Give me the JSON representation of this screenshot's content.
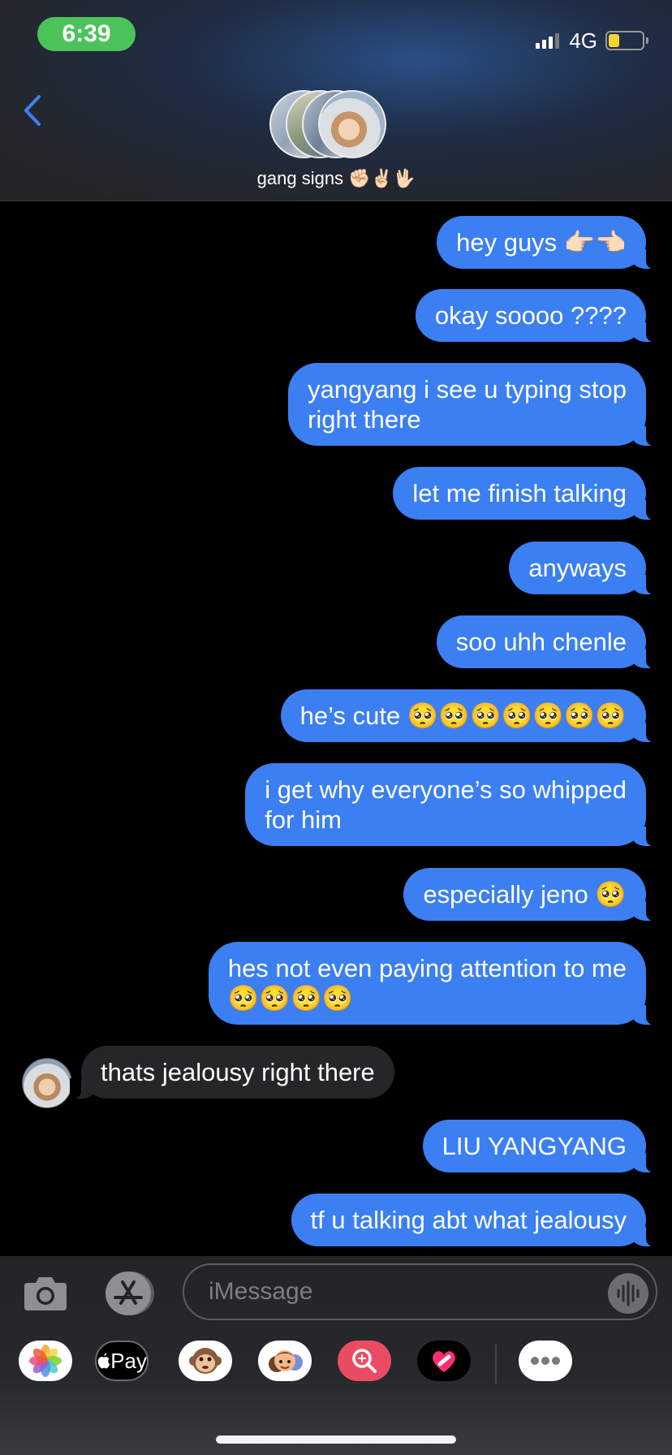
{
  "status_bar": {
    "time": "6:39",
    "network": "4G",
    "signal_bars": 3,
    "battery_level": 0.35
  },
  "header": {
    "back_icon": "chevron-left-icon",
    "group_name": "gang signs ✊🏻✌🏻🖖🏻"
  },
  "messages": [
    {
      "direction": "outgoing",
      "lines": [
        "hey guys 👉🏻👈🏻"
      ]
    },
    {
      "direction": "outgoing",
      "lines": [
        "okay soooo ????"
      ]
    },
    {
      "direction": "outgoing",
      "lines": [
        "yangyang i see u typing stop",
        "right there"
      ]
    },
    {
      "direction": "outgoing",
      "lines": [
        "let me finish talking"
      ]
    },
    {
      "direction": "outgoing",
      "lines": [
        "anyways"
      ]
    },
    {
      "direction": "outgoing",
      "lines": [
        "soo uhh chenle"
      ]
    },
    {
      "direction": "outgoing",
      "lines": [
        "he’s cute 🥺🥺🥺🥺🥺🥺🥺"
      ]
    },
    {
      "direction": "outgoing",
      "lines": [
        "i get why everyone’s so whipped",
        "for him"
      ]
    },
    {
      "direction": "outgoing",
      "lines": [
        "especially jeno 🥺"
      ]
    },
    {
      "direction": "outgoing",
      "lines": [
        "hes not even paying attention to me",
        "🥺🥺🥺🥺"
      ]
    },
    {
      "direction": "incoming",
      "lines": [
        "thats jealousy right there"
      ]
    },
    {
      "direction": "outgoing",
      "lines": [
        "LIU YANGYANG"
      ]
    },
    {
      "direction": "outgoing",
      "lines": [
        "tf u talking abt what jealousy"
      ]
    }
  ],
  "compose": {
    "placeholder": "iMessage",
    "camera_icon": "camera-icon",
    "appstore_icon": "app-store-icon",
    "audio_icon": "audio-waveform-icon",
    "apple_pay_label": "Pay",
    "apps": [
      "photos-app-icon",
      "apple-pay-icon",
      "animoji-monkey-icon",
      "memoji-icon",
      "image-search-icon",
      "digital-touch-heart-icon",
      "more-apps-icon"
    ]
  },
  "colors": {
    "outgoing_bubble": "#3b7ff2",
    "incoming_bubble": "#262628",
    "accent": "#3b82f6",
    "time_pill": "#4cc35a"
  }
}
